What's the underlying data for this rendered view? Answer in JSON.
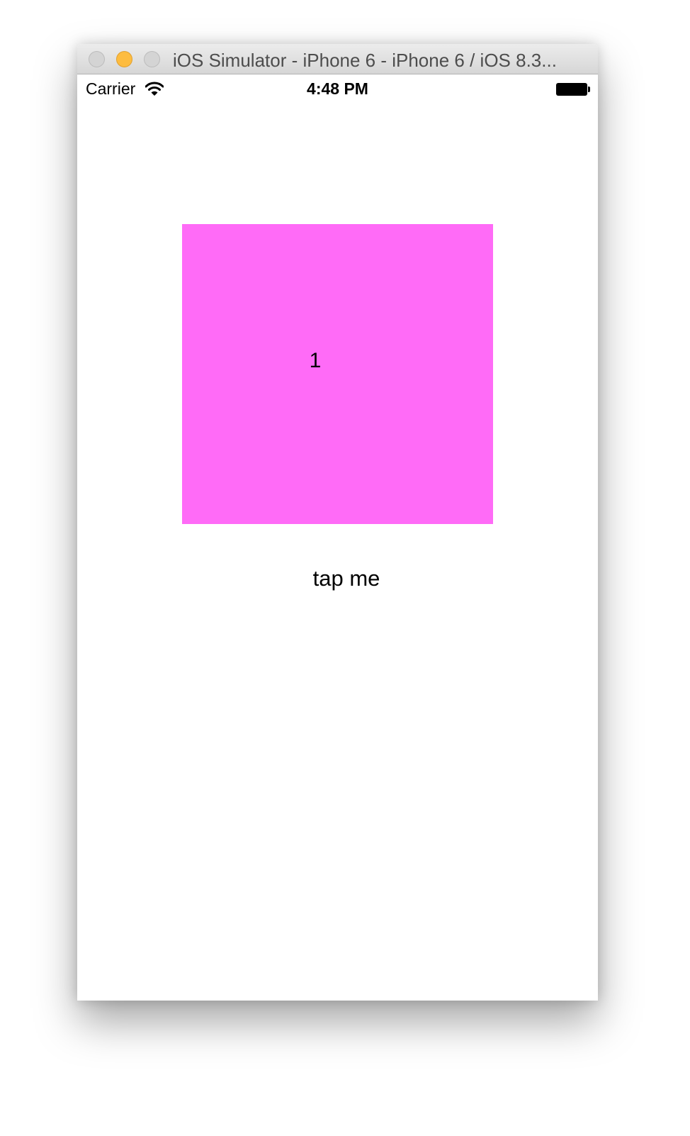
{
  "window": {
    "title": "iOS Simulator - iPhone 6 - iPhone 6 / iOS 8.3..."
  },
  "status_bar": {
    "carrier": "Carrier",
    "time": "4:48 PM",
    "wifi_icon": "wifi-icon",
    "battery_icon": "battery-icon",
    "battery_level": 1.0
  },
  "content": {
    "square_label": "1",
    "square_color": "#ff6bf7",
    "button_label": "tap me"
  }
}
